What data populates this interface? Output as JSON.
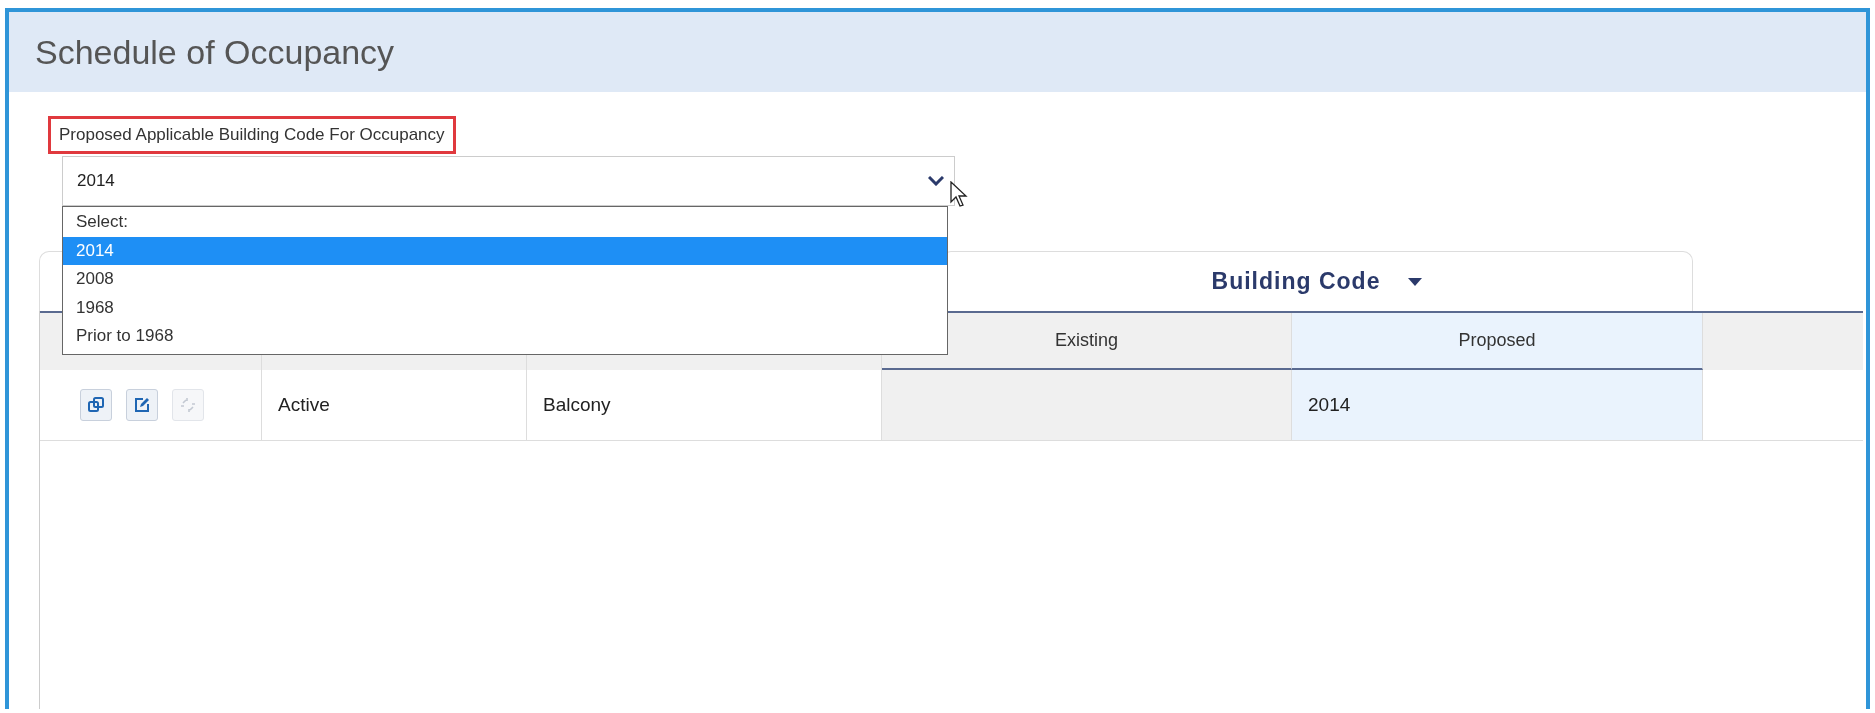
{
  "panel": {
    "title": "Schedule of Occupancy"
  },
  "field": {
    "label": "Proposed Applicable Building Code For Occupancy",
    "highlighted": true,
    "value": "2014",
    "expanded": true,
    "options": [
      {
        "label": "Select:",
        "selected": false
      },
      {
        "label": "2014",
        "selected": true
      },
      {
        "label": "2008",
        "selected": false
      },
      {
        "label": "1968",
        "selected": false
      },
      {
        "label": "Prior to 1968",
        "selected": false
      }
    ]
  },
  "table": {
    "group_header": "Building Code",
    "columns": [
      {
        "label": "Existing",
        "selected": false
      },
      {
        "label": "Proposed",
        "selected": true
      }
    ],
    "rows": [
      {
        "actions": [
          {
            "kind": "copy",
            "disabled": false
          },
          {
            "kind": "edit",
            "disabled": false
          },
          {
            "kind": "link",
            "disabled": true
          }
        ],
        "status": "Active",
        "type": "Balcony",
        "proposed": "2014"
      }
    ]
  }
}
